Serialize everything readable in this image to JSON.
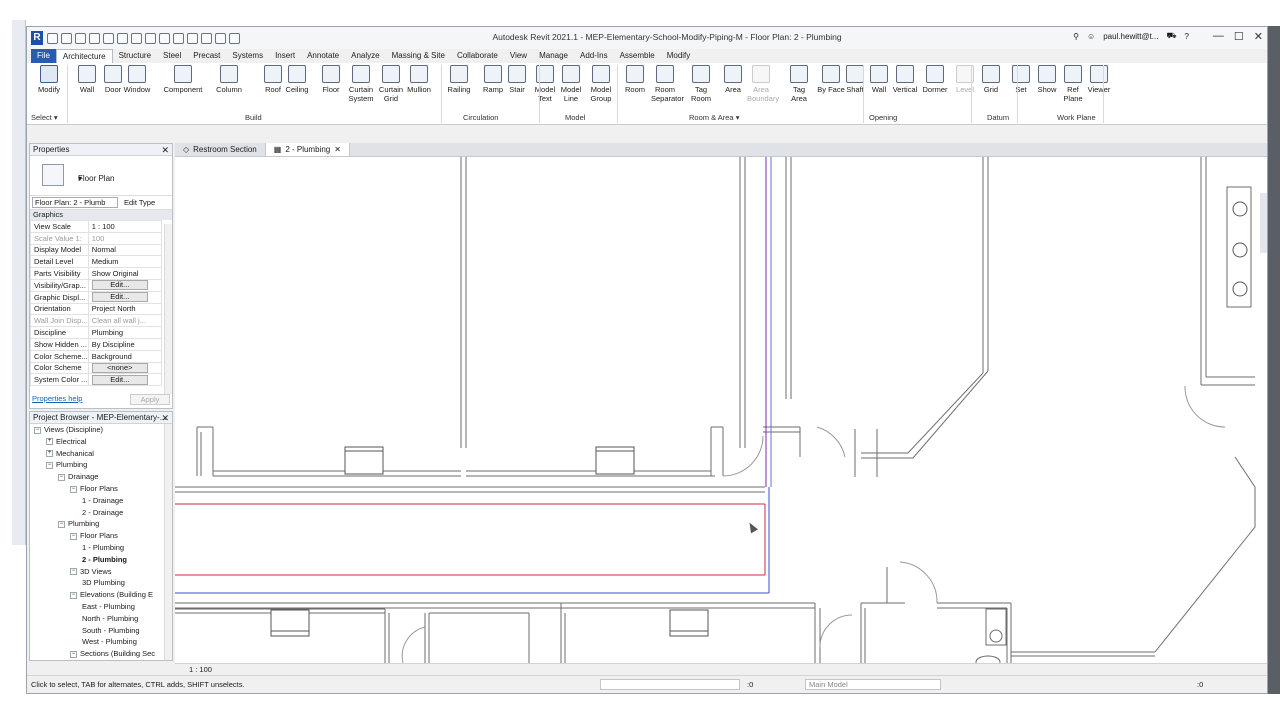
{
  "window": {
    "title": "Autodesk Revit 2021.1 - MEP-Elementary-School-Modify-Piping-M - Floor Plan: 2 - Plumbing",
    "user": "paul.hewitt@t...",
    "controls": [
      "—",
      "☐",
      "✕"
    ]
  },
  "menu_tabs": [
    "File",
    "Architecture",
    "Structure",
    "Steel",
    "Precast",
    "Systems",
    "Insert",
    "Annotate",
    "Analyze",
    "Massing & Site",
    "Collaborate",
    "View",
    "Manage",
    "Add-Ins",
    "Assemble",
    "Modify"
  ],
  "active_tab": "Architecture",
  "ribbon": {
    "buttons": [
      {
        "label": "Modify",
        "icon": "modify-cursor-icon"
      },
      {
        "label": "Wall",
        "icon": "wall-icon"
      },
      {
        "label": "Door",
        "icon": "door-icon"
      },
      {
        "label": "Window",
        "icon": "window-icon"
      },
      {
        "label": "Component",
        "icon": "component-icon"
      },
      {
        "label": "Column",
        "icon": "column-icon"
      },
      {
        "label": "Roof",
        "icon": "roof-icon"
      },
      {
        "label": "Ceiling",
        "icon": "ceiling-icon"
      },
      {
        "label": "Floor",
        "icon": "floor-icon"
      },
      {
        "label": "Curtain System",
        "icon": "curtain-system-icon"
      },
      {
        "label": "Curtain Grid",
        "icon": "curtain-grid-icon"
      },
      {
        "label": "Mullion",
        "icon": "mullion-icon"
      },
      {
        "label": "Railing",
        "icon": "railing-icon"
      },
      {
        "label": "Ramp",
        "icon": "ramp-icon"
      },
      {
        "label": "Stair",
        "icon": "stair-icon"
      },
      {
        "label": "Model Text",
        "icon": "model-text-icon"
      },
      {
        "label": "Model Line",
        "icon": "model-line-icon"
      },
      {
        "label": "Model Group",
        "icon": "model-group-icon"
      },
      {
        "label": "Room",
        "icon": "room-icon"
      },
      {
        "label": "Room Separator",
        "icon": "room-separator-icon"
      },
      {
        "label": "Tag Room",
        "icon": "tag-room-icon"
      },
      {
        "label": "Area",
        "icon": "area-icon"
      },
      {
        "label": "Area Boundary",
        "icon": "area-boundary-icon",
        "disabled": true
      },
      {
        "label": "Tag Area",
        "icon": "tag-area-icon"
      },
      {
        "label": "By Face",
        "icon": "by-face-icon"
      },
      {
        "label": "Shaft",
        "icon": "shaft-icon"
      },
      {
        "label": "Wall",
        "icon": "wall-opening-icon"
      },
      {
        "label": "Vertical",
        "icon": "vertical-opening-icon"
      },
      {
        "label": "Dormer",
        "icon": "dormer-icon"
      },
      {
        "label": "Level",
        "icon": "level-icon",
        "disabled": true
      },
      {
        "label": "Grid",
        "icon": "grid-icon"
      },
      {
        "label": "Set",
        "icon": "set-workplane-icon"
      },
      {
        "label": "Show",
        "icon": "show-workplane-icon"
      },
      {
        "label": "Ref Plane",
        "icon": "ref-plane-icon"
      },
      {
        "label": "Viewer",
        "icon": "viewer-icon"
      }
    ],
    "panels": [
      "Select ▾",
      "Build",
      "Circulation",
      "Model",
      "Room & Area ▾",
      "Opening",
      "Datum",
      "Work Plane"
    ]
  },
  "properties": {
    "title": "Properties",
    "type_name": "Floor Plan",
    "instance_selector": "Floor Plan: 2 - Plumb",
    "edit_type": "Edit Type",
    "group": "Graphics",
    "rows": [
      {
        "k": "View Scale",
        "v": "1 : 100"
      },
      {
        "k": "Scale Value   1:",
        "v": "100",
        "dim": true
      },
      {
        "k": "Display Model",
        "v": "Normal"
      },
      {
        "k": "Detail Level",
        "v": "Medium"
      },
      {
        "k": "Parts Visibility",
        "v": "Show Original"
      },
      {
        "k": "Visibility/Grap...",
        "v": "Edit...",
        "btn": true
      },
      {
        "k": "Graphic Displ...",
        "v": "Edit...",
        "btn": true
      },
      {
        "k": "Orientation",
        "v": "Project North"
      },
      {
        "k": "Wall Join Disp...",
        "v": "Clean all wall j...",
        "dim": true
      },
      {
        "k": "Discipline",
        "v": "Plumbing"
      },
      {
        "k": "Show Hidden ...",
        "v": "By Discipline"
      },
      {
        "k": "Color Scheme...",
        "v": "Background"
      },
      {
        "k": "Color Scheme",
        "v": "<none>",
        "btn": true
      },
      {
        "k": "System Color ...",
        "v": "Edit...",
        "btn": true
      }
    ],
    "help": "Properties help",
    "apply": "Apply"
  },
  "browser": {
    "title": "Project Browser - MEP-Elementary-...",
    "items": [
      {
        "d": 0,
        "t": "-",
        "label": "Views (Discipline)"
      },
      {
        "d": 1,
        "t": "+",
        "label": "Electrical"
      },
      {
        "d": 1,
        "t": "+",
        "label": "Mechanical"
      },
      {
        "d": 1,
        "t": "-",
        "label": "Plumbing"
      },
      {
        "d": 2,
        "t": "-",
        "label": "Drainage"
      },
      {
        "d": 3,
        "t": "-",
        "label": "Floor Plans"
      },
      {
        "d": 4,
        "t": "",
        "label": "1 - Drainage"
      },
      {
        "d": 4,
        "t": "",
        "label": "2 - Drainage"
      },
      {
        "d": 2,
        "t": "-",
        "label": "Plumbing"
      },
      {
        "d": 3,
        "t": "-",
        "label": "Floor Plans"
      },
      {
        "d": 4,
        "t": "",
        "label": "1 - Plumbing"
      },
      {
        "d": 4,
        "t": "",
        "label": "2 - Plumbing",
        "sel": true
      },
      {
        "d": 3,
        "t": "-",
        "label": "3D Views"
      },
      {
        "d": 4,
        "t": "",
        "label": "3D Plumbing"
      },
      {
        "d": 3,
        "t": "-",
        "label": "Elevations (Building E"
      },
      {
        "d": 4,
        "t": "",
        "label": "East - Plumbing"
      },
      {
        "d": 4,
        "t": "",
        "label": "North - Plumbing"
      },
      {
        "d": 4,
        "t": "",
        "label": "South - Plumbing"
      },
      {
        "d": 4,
        "t": "",
        "label": "West - Plumbing"
      },
      {
        "d": 3,
        "t": "-",
        "label": "Sections (Building Sec"
      }
    ]
  },
  "doc_tabs": [
    {
      "label": "Restroom Section",
      "active": false
    },
    {
      "label": "2 - Plumbing",
      "active": true
    }
  ],
  "view_bar": {
    "scale": "1 : 100"
  },
  "status": {
    "hint": "Click to select, TAB for alternates, CTRL adds, SHIFT unselects.",
    "zero_count": ":0",
    "model": "Main Model",
    "filter_count": ":0"
  },
  "colors": {
    "accent": "#2a5cae",
    "pipe_red": "#d0284a",
    "pipe_blue": "#3b4fd0",
    "pipe_purple": "#7a2fa8"
  }
}
